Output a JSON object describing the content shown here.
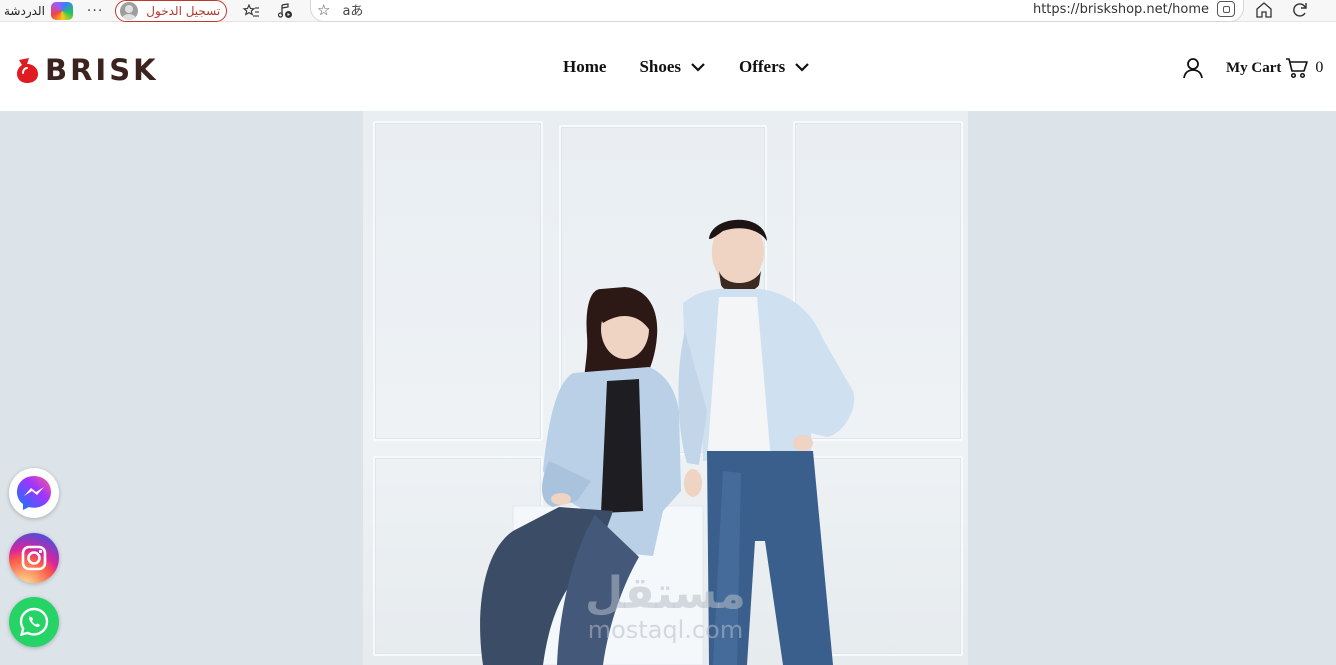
{
  "browser": {
    "copilot_label": "الدردشة",
    "more_label": "···",
    "signin_label": "تسجيل الدخول",
    "translate_glyph": "aあ",
    "url": "https://briskshop.net/home"
  },
  "header": {
    "logo_text": "BRISK",
    "nav": [
      {
        "label": "Home",
        "has_dropdown": false
      },
      {
        "label": "Shoes",
        "has_dropdown": true
      },
      {
        "label": "Offers",
        "has_dropdown": true
      }
    ],
    "cart_label": "My Cart",
    "cart_count": "0"
  },
  "hero": {
    "watermark_ar": "مستقل",
    "watermark_latin": "mostaql.com"
  },
  "social": [
    "messenger-icon",
    "instagram-icon",
    "whatsapp-icon"
  ],
  "colors": {
    "brand_red": "#e01b22",
    "brand_dark": "#3d2320",
    "hero_bg": "#dde4e9",
    "whatsapp": "#25d366"
  }
}
